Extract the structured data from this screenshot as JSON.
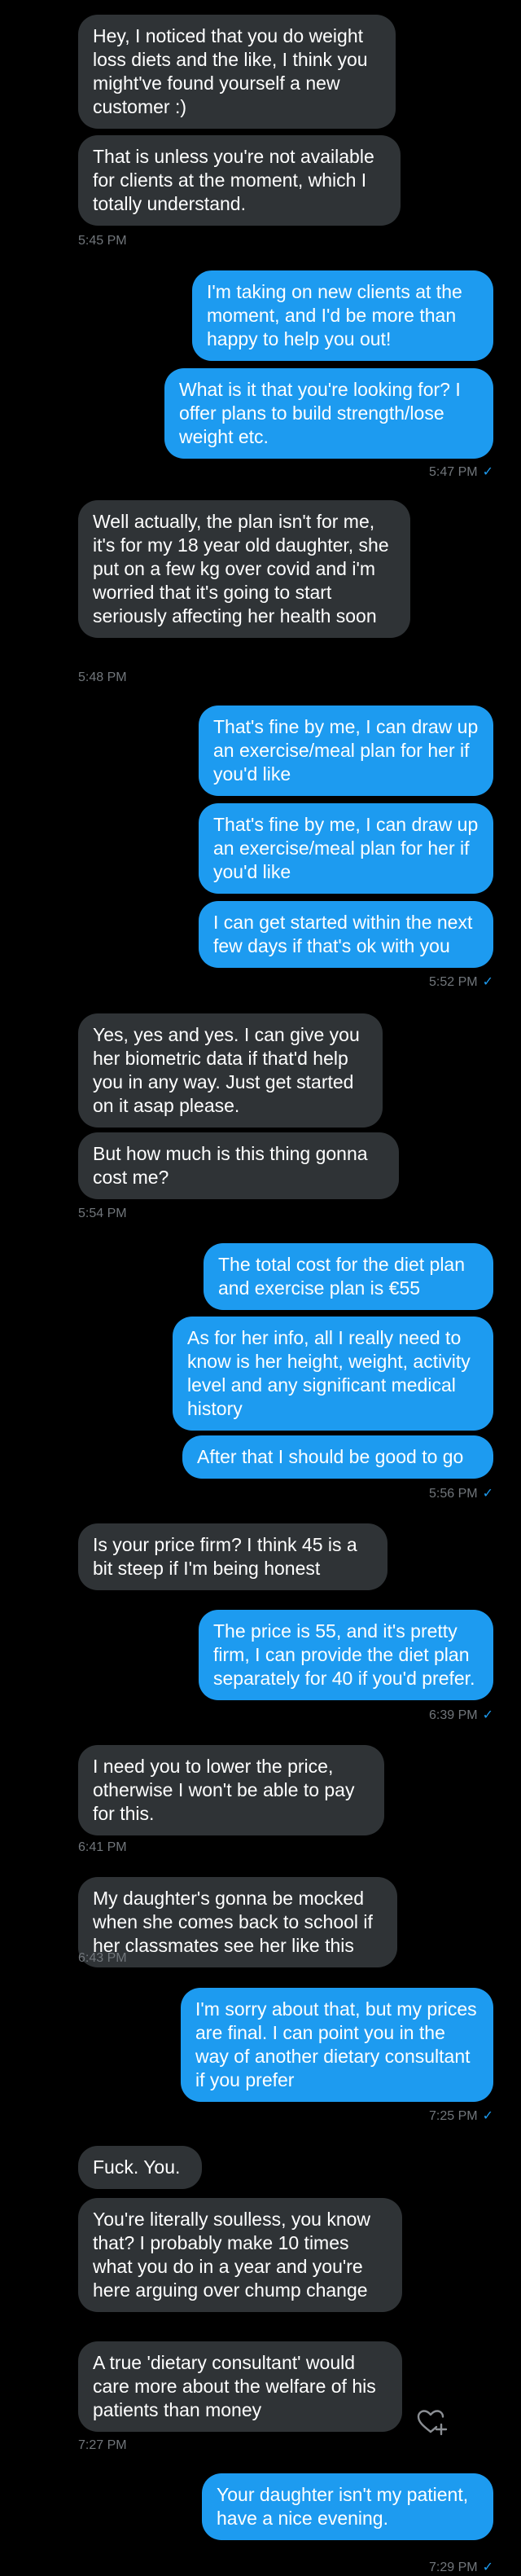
{
  "messages": [
    {
      "text": "Hey, I noticed that you do weight loss diets and the like, I think you might've found yourself a new customer :)"
    },
    {
      "text": "That is unless you're not available for clients at the moment, which I totally understand."
    },
    {
      "text": "I'm taking on new clients at the moment, and I'd be more than happy to help you out!"
    },
    {
      "text": "What is it that you're looking for? I offer plans to build strength/lose weight etc."
    },
    {
      "text": "Well actually, the plan isn't for me, it's for my 18 year old daughter, she put on a few kg over covid and i'm worried that it's going to start seriously affecting her health soon"
    },
    {
      "text": "That's fine by me, I can draw up an exercise/meal plan for her if you'd like"
    },
    {
      "text": "That's fine by me, I can draw up an exercise/meal plan for her if you'd like"
    },
    {
      "text": "I can get started within the next few days if that's ok with you"
    },
    {
      "text": "Yes, yes and yes. I can give you her biometric data if that'd help you in any way. Just get started on it asap please."
    },
    {
      "text": "But how much is this thing gonna cost me?"
    },
    {
      "text": "The total cost for the diet plan and exercise plan is €55"
    },
    {
      "text": "As for her info, all I really need to know is her height, weight, activity level and any significant medical history"
    },
    {
      "text": "After that I should be good to go"
    },
    {
      "text": "Is your price firm? I think 45 is a bit steep if I'm being honest"
    },
    {
      "text": "The price is 55, and it's pretty firm, I can provide the diet plan separately for 40 if you'd prefer."
    },
    {
      "text": "I need you to lower the price, otherwise I won't be able to pay for this."
    },
    {
      "text": "My daughter's gonna be mocked when she comes back to school if her classmates see her like this"
    },
    {
      "text": "I'm sorry about that, but my prices are final. I can point you in the way of another dietary consultant if you prefer"
    },
    {
      "text": "Fuck. You."
    },
    {
      "text": "You're literally soulless, you know that? I probably make 10 times what you do in a year and you're here arguing over chump change"
    },
    {
      "text": "A true 'dietary consultant' would care more about the welfare of his patients than money"
    },
    {
      "text": "Your daughter isn't my patient, have a nice evening."
    }
  ],
  "timestamps": [
    "5:45 PM",
    "5:47 PM",
    "5:48 PM",
    "5:52 PM",
    "5:54 PM",
    "5:56 PM",
    "6:39 PM",
    "6:41 PM",
    "6:43 PM",
    "7:25 PM",
    "7:27 PM",
    "7:29 PM"
  ],
  "read_receipt_icon": "check-icon",
  "react_icon": "heart-plus-icon",
  "colors": {
    "background": "#000000",
    "incoming_bubble": "#2f3336",
    "outgoing_bubble": "#1d9bf0",
    "timestamp": "#71767b",
    "text": "#ffffff"
  }
}
